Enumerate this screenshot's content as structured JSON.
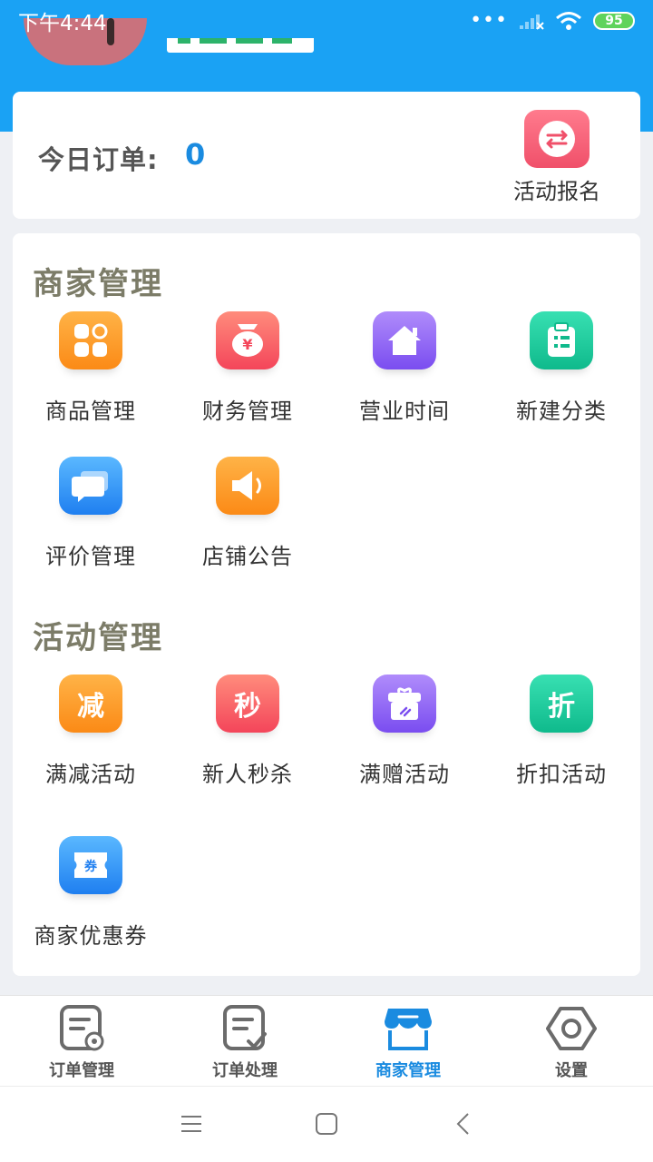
{
  "status_bar": {
    "time": "下午4:44",
    "signal_dots": "•••",
    "battery": "95"
  },
  "order_card": {
    "label": "今日订单:",
    "count": "0",
    "activity_button": {
      "label": "活动报名",
      "icon": "swap-arrows-icon"
    }
  },
  "merchant_section": {
    "title": "商家管理",
    "items": [
      {
        "label": "商品管理",
        "icon": "grid-apps-icon",
        "color": "#fb8a16"
      },
      {
        "label": "财务管理",
        "icon": "money-bag-icon",
        "color": "#f4455a"
      },
      {
        "label": "营业时间",
        "icon": "house-icon",
        "color": "#7a4df0"
      },
      {
        "label": "新建分类",
        "icon": "clipboard-icon",
        "color": "#0fba8c"
      },
      {
        "label": "评价管理",
        "icon": "chat-bubble-icon",
        "color": "#1f7ff0"
      },
      {
        "label": "店铺公告",
        "icon": "speaker-icon",
        "color": "#fb8a16"
      }
    ]
  },
  "activity_section": {
    "title": "活动管理",
    "items": [
      {
        "label": "满减活动",
        "glyph": "减",
        "icon": "discount-icon",
        "color": "#fb8a16"
      },
      {
        "label": "新人秒杀",
        "glyph": "秒",
        "icon": "flash-sale-icon",
        "color": "#f4455a"
      },
      {
        "label": "满赠活动",
        "glyph": "",
        "icon": "gift-box-icon",
        "color": "#7a4df0"
      },
      {
        "label": "折扣活动",
        "glyph": "折",
        "icon": "discount-tag-icon",
        "color": "#0fba8c"
      },
      {
        "label": "商家优惠券",
        "glyph": "券",
        "icon": "coupon-icon",
        "color": "#1f7ff0"
      }
    ]
  },
  "bottom_nav": {
    "items": [
      {
        "label": "订单管理",
        "icon": "order-settings-icon",
        "active": false
      },
      {
        "label": "订单处理",
        "icon": "order-check-icon",
        "active": false
      },
      {
        "label": "商家管理",
        "icon": "storefront-icon",
        "active": true
      },
      {
        "label": "设置",
        "icon": "hex-gear-icon",
        "active": false
      }
    ]
  },
  "colors": {
    "header_blue": "#1aa2f4",
    "accent_blue": "#1a8be0",
    "section_title": "#7c7c68"
  }
}
